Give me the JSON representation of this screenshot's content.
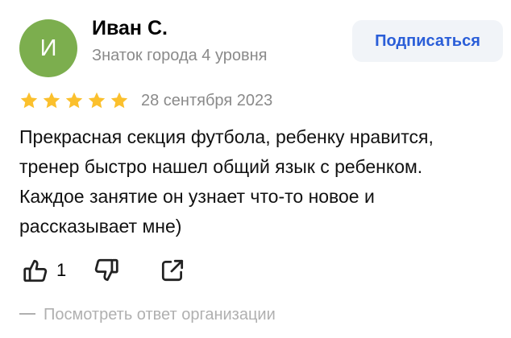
{
  "author": {
    "avatar_letter": "И",
    "avatar_color": "#7cae4e",
    "name": "Иван С.",
    "status": "Знаток города 4 уровня"
  },
  "subscribe_label": "Подписаться",
  "review": {
    "rating": 5,
    "max_rating": 5,
    "star_color": "#fbc02d",
    "date": "28 сентября 2023",
    "text": "Прекрасная секция футбола, ребенку нравится, тренер быстро нашел общий язык с ребенком. Каждое занятие он узнает что-то новое и рассказывает мне)"
  },
  "actions": {
    "like_icon": "thumbs-up-icon",
    "like_count": "1",
    "dislike_icon": "thumbs-down-icon",
    "share_icon": "share-icon"
  },
  "org_reply_label": "Посмотреть ответ организации"
}
